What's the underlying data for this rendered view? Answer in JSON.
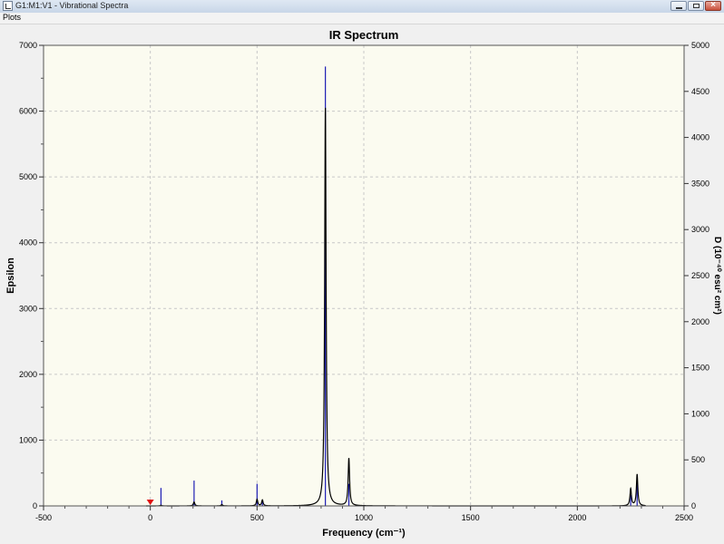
{
  "window": {
    "title": "G1:M1:V1 - Vibrational Spectra",
    "menu": [
      "Plots"
    ]
  },
  "colors": {
    "plot_background": "#fbfbf0",
    "spectrum_line": "#000000",
    "stick_bars": "#1c1cb4",
    "marker": "#e01010",
    "grid": "#c8c8c8"
  },
  "chart_data": {
    "type": "line",
    "title": "IR Spectrum",
    "xlabel": "Frequency (cm⁻¹)",
    "ylabel_left": "Epsilon",
    "ylabel_right": "D (10⁻⁴⁰ esu² cm²)",
    "xlim": [
      -500,
      2500
    ],
    "ylim_left": [
      0,
      7000
    ],
    "ylim_right": [
      0,
      5000
    ],
    "x_ticks": [
      -500,
      0,
      500,
      1000,
      1500,
      2000,
      2500
    ],
    "y_ticks_left": [
      0,
      1000,
      2000,
      3000,
      4000,
      5000,
      6000,
      7000
    ],
    "y_ticks_right": [
      0,
      500,
      1000,
      1500,
      2000,
      2500,
      3000,
      3500,
      4000,
      4500,
      5000
    ],
    "grid": true,
    "marker_at_x": 0,
    "series": [
      {
        "kind": "spectrum_peaks",
        "axis": "left",
        "peaks": [
          {
            "x": 50,
            "epsilon": 10
          },
          {
            "x": 205,
            "epsilon": 60
          },
          {
            "x": 335,
            "epsilon": 20
          },
          {
            "x": 500,
            "epsilon": 100
          },
          {
            "x": 525,
            "epsilon": 90
          },
          {
            "x": 820,
            "epsilon": 6050
          },
          {
            "x": 930,
            "epsilon": 720
          },
          {
            "x": 2250,
            "epsilon": 260
          },
          {
            "x": 2280,
            "epsilon": 480
          }
        ]
      },
      {
        "kind": "sticks",
        "axis": "right",
        "values": [
          {
            "x": 50,
            "D": 195
          },
          {
            "x": 205,
            "D": 275
          },
          {
            "x": 335,
            "D": 60
          },
          {
            "x": 500,
            "D": 240
          },
          {
            "x": 525,
            "D": 60
          },
          {
            "x": 820,
            "D": 4770
          },
          {
            "x": 930,
            "D": 240
          },
          {
            "x": 2250,
            "D": 120
          },
          {
            "x": 2280,
            "D": 305
          }
        ]
      }
    ]
  }
}
